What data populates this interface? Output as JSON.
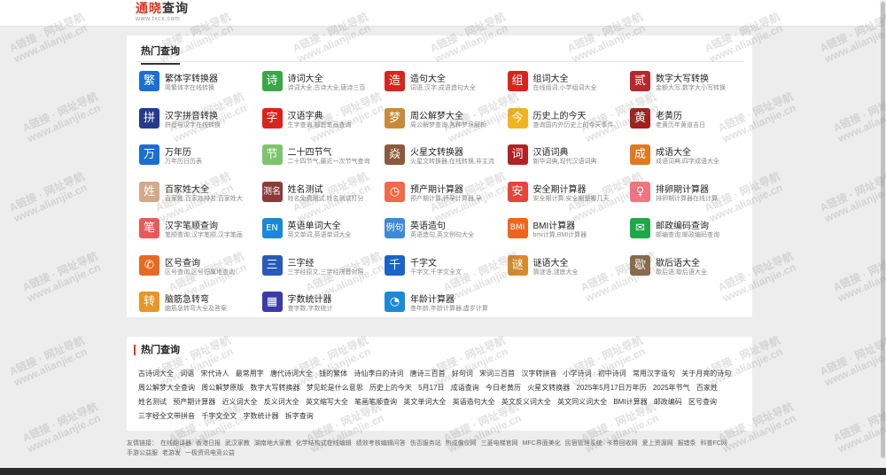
{
  "header": {
    "logo_a": "通晓",
    "logo_b": "查询",
    "logo_sub": "www.txcx.com"
  },
  "tools_title": "热门查询",
  "colors": {
    "brand": "#e8321c",
    "icon_blue": "#1a6fd0",
    "icon_green": "#3aa64a",
    "icon_red": "#d9241c",
    "icon_orange": "#e8843a"
  },
  "tools": [
    {
      "name": "繁体字转换器",
      "desc": "简繁体字在线转换",
      "icon": "繁",
      "color": "#1a6fd0",
      "icon_name": "traditional-char-icon"
    },
    {
      "name": "诗词大全",
      "desc": "诗词大全,古诗大全,唐诗三百",
      "icon": "诗",
      "color": "#3aa64a",
      "icon_name": "poem-icon"
    },
    {
      "name": "造句大全",
      "desc": "词语,汉字,成语造句大全",
      "icon": "造",
      "color": "#d9241c",
      "icon_name": "sentence-icon"
    },
    {
      "name": "组词大全",
      "desc": "在线组词,小学组词大全",
      "icon": "组",
      "color": "#d9241c",
      "icon_name": "word-group-icon"
    },
    {
      "name": "数字大写转换",
      "desc": "金额大写,数字大小写转换",
      "icon": "贰",
      "color": "#b8272e",
      "icon_name": "number-icon"
    },
    {
      "name": "汉字拼音转换",
      "desc": "拼音与汉字在线转换",
      "icon": "拼",
      "color": "#243a8c",
      "icon_name": "pinyin-icon"
    },
    {
      "name": "汉语字典",
      "desc": "生字查询,部首笔画查询",
      "icon": "字",
      "color": "#d9241c",
      "icon_name": "dictionary-icon"
    },
    {
      "name": "周公解梦大全",
      "desc": "周公解梦查询,各种梦境解析",
      "icon": "梦",
      "color": "#c88a3a",
      "icon_name": "dream-icon"
    },
    {
      "name": "历史上的今天",
      "desc": "查询国内外历史上的今天事件",
      "icon": "今",
      "color": "#f0b422",
      "icon_name": "history-icon"
    },
    {
      "name": "老黄历",
      "desc": "老黄历年黄道吉日",
      "icon": "黄",
      "color": "#a0201c",
      "icon_name": "almanac-icon"
    },
    {
      "name": "万年历",
      "desc": "万年历日历表",
      "icon": "万",
      "color": "#1a6fd0",
      "icon_name": "calendar-icon"
    },
    {
      "name": "二十四节气",
      "desc": "二十四节气,最近一次节气查询",
      "icon": "节",
      "color": "#7cc56c",
      "icon_name": "solar-term-icon"
    },
    {
      "name": "火星文转换器",
      "desc": "火星文转换器,在线转换,非主流",
      "icon": "焱",
      "color": "#8a5a3c",
      "icon_name": "martian-text-icon"
    },
    {
      "name": "汉语词典",
      "desc": "新华词典,现代汉语词典",
      "icon": "词",
      "color": "#b22222",
      "icon_name": "word-dictionary-icon"
    },
    {
      "name": "成语大全",
      "desc": "成语词典,四字成语大全",
      "icon": "成",
      "color": "#e07a1f",
      "icon_name": "idiom-icon"
    },
    {
      "name": "百家姓大全",
      "desc": "百家姓,百家姓排名,百家姓大",
      "icon": "姓",
      "color": "#d4a888",
      "icon_name": "surname-icon"
    },
    {
      "name": "姓名测试",
      "desc": "姓名免费测试,姓名测试打分",
      "icon": "测名",
      "color": "#8a3a3a",
      "icon_name": "name-test-icon"
    },
    {
      "name": "预产期计算器",
      "desc": "预产期计算,怀孕计算器,孕",
      "icon": "◷",
      "color": "#f06a4a",
      "icon_name": "due-date-icon"
    },
    {
      "name": "安全期计算器",
      "desc": "安全期计算,安全期是哪几天",
      "icon": "安",
      "color": "#e8443c",
      "icon_name": "safe-period-icon"
    },
    {
      "name": "排卵期计算器",
      "desc": "排卵期计算器在线计算",
      "icon": "♀",
      "color": "#f27480",
      "icon_name": "ovulation-icon"
    },
    {
      "name": "汉字笔顺查询",
      "desc": "笔顺查询,汉字笔顺,汉字笔画",
      "icon": "笔",
      "color": "#e85a5a",
      "icon_name": "stroke-order-icon"
    },
    {
      "name": "英语单词大全",
      "desc": "英文单词,英语单词大全",
      "icon": "EN",
      "color": "#1a8ad8",
      "icon_name": "english-word-icon"
    },
    {
      "name": "英语造句",
      "desc": "英语造句,英文例句大全",
      "icon": "例句",
      "color": "#3a8ad8",
      "icon_name": "english-sentence-icon"
    },
    {
      "name": "BMI计算器",
      "desc": "bmi计算,BMI计算器",
      "icon": "BMI",
      "color": "#f0651e",
      "icon_name": "bmi-icon"
    },
    {
      "name": "邮政编码查询",
      "desc": "邮编查询,邮政编码查询",
      "icon": "✉",
      "color": "#1ea84a",
      "icon_name": "postcode-icon"
    },
    {
      "name": "区号查询",
      "desc": "区号查询,区号归属地查询",
      "icon": "✆",
      "color": "#e86a1e",
      "icon_name": "area-code-icon"
    },
    {
      "name": "三字经",
      "desc": "三字经原文,三字经拼音对照",
      "icon": "三",
      "color": "#2a5ab8",
      "icon_name": "three-char-classic-icon"
    },
    {
      "name": "千字文",
      "desc": "千字文,千字文全文",
      "icon": "千",
      "color": "#1a64c8",
      "icon_name": "thousand-char-icon"
    },
    {
      "name": "谜语大全",
      "desc": "猜谜语,谜底大全",
      "icon": "谜",
      "color": "#d88a2a",
      "icon_name": "riddle-icon"
    },
    {
      "name": "歇后语大全",
      "desc": "歇后语,歇后语大全",
      "icon": "歇",
      "color": "#8a6a4a",
      "icon_name": "allegorical-saying-icon"
    },
    {
      "name": "脑筋急转弯",
      "desc": "脑筋急转弯大全及答案",
      "icon": "转",
      "color": "#e8962a",
      "icon_name": "brain-teaser-icon"
    },
    {
      "name": "字数统计器",
      "desc": "查字数,字数统计",
      "icon": "▦",
      "color": "#3a3aa8",
      "icon_name": "word-count-icon"
    },
    {
      "name": "年龄计算器",
      "desc": "查年龄,年龄计算器,虚岁计算",
      "icon": "◔",
      "color": "#1a8ad8",
      "icon_name": "age-icon"
    }
  ],
  "hot_title": "热门查询",
  "hot_links": [
    "古诗词大全",
    "词语",
    "宋代诗人",
    "最常用字",
    "唐代诗词大全",
    "钱的繁体",
    "诗仙李白的诗词",
    "唐诗三百首",
    "好句词",
    "宋词三百首",
    "汉字转拼音",
    "小学诗词",
    "初中诗词",
    "常用汉字造句",
    "关于月亮的诗句",
    "周公解梦大全查询",
    "周公解梦原版",
    "数字大写转换器",
    "梦见蛇是什么意思",
    "历史上的今天",
    "5月17日",
    "成语查询",
    "今日老黄历",
    "火星文转换器",
    "2025年5月17日万年历",
    "2025年节气",
    "百家姓",
    "姓名测试",
    "预产期计算器",
    "近义词大全",
    "反义词大全",
    "英文缩写大全",
    "笔画笔顺查询",
    "英文单词大全",
    "英语造句大全",
    "英文反义词大全",
    "英文同义词大全",
    "BMI计算器",
    "邮政编码",
    "区号查询",
    "三字经全文带拼音",
    "千字文全文",
    "字数统计器",
    "拆字查询"
  ],
  "footer": {
    "label": "友情链接：",
    "links": [
      "在线翻译器",
      "香港日报",
      "武汉家教",
      "湖南地大家教",
      "化学结构式在线编辑",
      "绩效考核编辑问答",
      "伤否服务站",
      "热成像仪网",
      "三菱电梯官网",
      "MFC界面美化",
      "民宿管理系统",
      "卡券回收网",
      "爱上资源网",
      "报错条",
      "科普FC网",
      "手游公益服",
      "老游发",
      "一极资讯电竞公益"
    ]
  },
  "watermark": {
    "line1": "A链接 · 网址导航",
    "line2": "www.alianjie.cn"
  }
}
